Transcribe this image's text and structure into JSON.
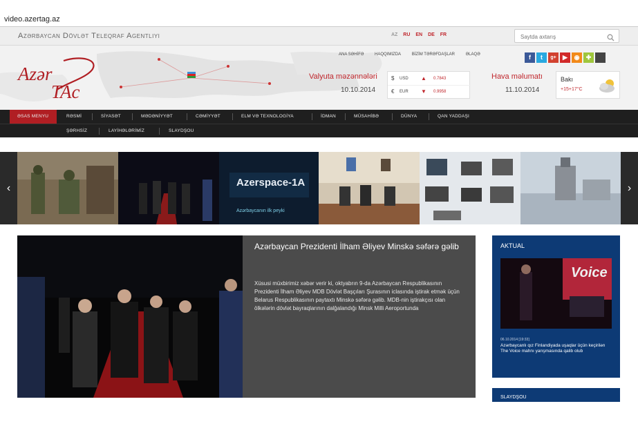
{
  "browser": {
    "url": "video.azertag.az"
  },
  "topbar": {
    "agency_name": "Azərbaycan Dövlət Teleqraf Agentliyi",
    "languages": [
      {
        "code": "AZ",
        "active": true
      },
      {
        "code": "RU",
        "active": false
      },
      {
        "code": "EN",
        "active": false
      },
      {
        "code": "DE",
        "active": false
      },
      {
        "code": "FR",
        "active": false
      }
    ],
    "search_placeholder": "Saytda axtarış"
  },
  "header": {
    "logo_text_line1": "Azər",
    "logo_text_line2": "TAc",
    "links": [
      "ANA SƏHİFƏ",
      "HAQQIMIZDA",
      "BİZİM TƏRƏFDAŞLAR",
      "ƏLAQƏ"
    ],
    "social_icons": [
      "facebook-icon",
      "twitter-icon",
      "googleplus-icon",
      "youtube-icon",
      "rss-icon",
      "android-icon",
      "apple-icon"
    ],
    "currency": {
      "title": "Valyuta məzənnələri",
      "date": "10.10.2014",
      "rows": [
        {
          "symbol": "$",
          "code": "USD",
          "trend": "up",
          "value": "0.7843"
        },
        {
          "symbol": "€",
          "code": "EUR",
          "trend": "down",
          "value": "0.9958"
        }
      ]
    },
    "weather": {
      "title": "Hava məlumatı",
      "date": "11.10.2014",
      "city": "Bakı",
      "temp": "+15+17°C"
    }
  },
  "nav": {
    "row1": [
      "ƏSAS MENYU",
      "RƏSMİ",
      "SİYASƏT",
      "MƏDƏNİYYƏT",
      "CƏMİYYƏT",
      "ELM VƏ TEXNOLOGİYA",
      "İDMAN",
      "MÜSAHİBƏ",
      "DÜNYA",
      "QAN YADDAŞI"
    ],
    "row2": [
      "ŞƏRHSİZ",
      "LAYİHƏLƏRİMİZ",
      "SLAYDŞOU"
    ]
  },
  "slider": {
    "prev": "‹",
    "next": "›",
    "azerspace_title": "Azerspace-1A",
    "azerspace_sub": "Azərbaycanın ilk peyki"
  },
  "main_article": {
    "title": "Azərbaycan Prezidenti İlham Əliyev Minskə səfərə gəlib",
    "body": "Xüsusi müxbirimiz xəbər verir ki, oktyabrın 9-da Azərbaycan Respublikasının Prezidenti İlham Əliyev MDB Dövlət Başçıları Şurasının iclasında iştirak etmək üçün Belarus Respublikasının paytaxtı Minskə səfərə gəlib. MDB-nin iştirakçısı olan ölkələrin dövlət bayraqlarının dalğalandığı Minsk Milli Aeroportunda"
  },
  "aktual": {
    "label": "AKTUAL",
    "photo_text": "Voice",
    "date": "06.10.2014 [19:33]",
    "text": "Azərbaycanlı qız Finlandiyada uşaqlar üçün keçirilən The Voice mahnı yarışmasında qalib olub"
  },
  "slaydsou": {
    "label": "SLAYDŞOU"
  },
  "colors": {
    "brand_red": "#c0272d",
    "nav_dark": "#1f1f1f",
    "aktual_blue": "#0d3a75",
    "article_gray": "#4b4b4b"
  }
}
